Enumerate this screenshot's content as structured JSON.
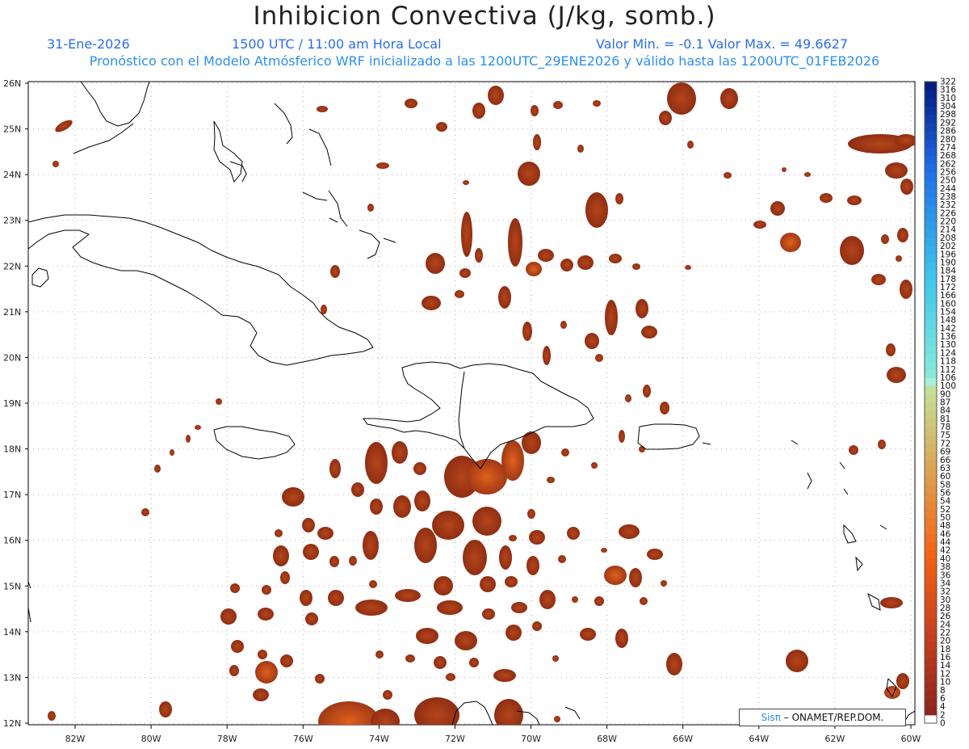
{
  "header": {
    "title": "Inhibicion Convectiva (J/kg, somb.)",
    "date": "31-Ene-2026",
    "time": "1500 UTC / 11:00 am Hora Local",
    "minmax": "Valor Min. = -0.1  Valor Max. = 49.6627",
    "forecast": "Pronóstico con el Modelo Atmósferico WRF inicializado a las 1200UTC_29ENE2026 y válido hasta las  1200UTC_01FEB2026"
  },
  "map": {
    "lat_labels": [
      "26N",
      "25N",
      "24N",
      "23N",
      "22N",
      "21N",
      "20N",
      "19N",
      "18N",
      "17N",
      "16N",
      "15N",
      "14N",
      "13N",
      "12N"
    ],
    "lon_labels": [
      "82W",
      "80W",
      "78W",
      "76W",
      "74W",
      "72W",
      "70W",
      "68W",
      "66W",
      "64W",
      "62W",
      "60W"
    ],
    "lat_range": [
      12,
      26
    ],
    "lon_range": [
      -83,
      -60
    ],
    "grid": "dotted",
    "shade_color": "#8f2e14",
    "core_color": "#c24a18"
  },
  "colorbar": {
    "labels": [
      "0",
      "2",
      "4",
      "6",
      "8",
      "10",
      "12",
      "14",
      "16",
      "18",
      "20",
      "22",
      "24",
      "26",
      "28",
      "30",
      "32",
      "34",
      "36",
      "38",
      "40",
      "42",
      "44",
      "46",
      "48",
      "50",
      "52",
      "54",
      "56",
      "58",
      "60",
      "63",
      "66",
      "69",
      "72",
      "75",
      "78",
      "81",
      "84",
      "87",
      "90",
      "100",
      "106",
      "112",
      "118",
      "124",
      "130",
      "136",
      "142",
      "148",
      "154",
      "160",
      "166",
      "172",
      "178",
      "184",
      "190",
      "196",
      "202",
      "208",
      "214",
      "220",
      "226",
      "232",
      "238",
      "244",
      "250",
      "256",
      "262",
      "268",
      "274",
      "280",
      "286",
      "292",
      "298",
      "304",
      "310",
      "316",
      "322"
    ]
  },
  "credit": {
    "logo": "Sisπ",
    "text": " – ONAMET/REP.DOM."
  }
}
